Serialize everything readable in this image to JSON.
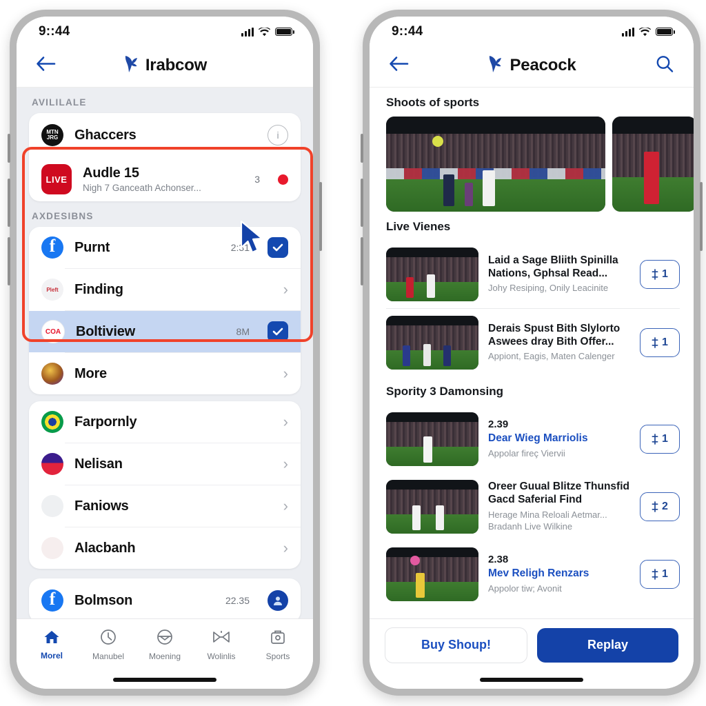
{
  "left_phone": {
    "status": {
      "time": "9::44"
    },
    "nav": {
      "brand": "Irabcow",
      "back_icon": "arrow-left-icon",
      "logo_icon": "peacock-logo-icon"
    },
    "sections": [
      {
        "label": "AVILILALE",
        "rows": [
          {
            "title": "Ghaccers",
            "sub": "",
            "avatar": "av-ghaccers",
            "avatar_text": "MTN JRG",
            "trailing": "info",
            "meta": ""
          },
          {
            "title": "Audle 15",
            "sub": "Nigh 7 Ganceath Achonser...",
            "avatar": "live",
            "avatar_text": "LIVE",
            "trailing": "reddot",
            "meta": "3"
          }
        ]
      },
      {
        "label": "AXDESIBNS",
        "highlighted": true,
        "rows": [
          {
            "title": "Purnt",
            "sub": "",
            "avatar": "av-fb",
            "avatar_text": "",
            "trailing": "check",
            "meta": "2:31"
          },
          {
            "title": "Finding",
            "sub": "",
            "avatar": "av-finding",
            "avatar_text": "Pleft",
            "trailing": "chevron",
            "meta": ""
          },
          {
            "title": "Boltiview",
            "sub": "",
            "avatar": "av-bolt",
            "avatar_text": "COA",
            "trailing": "check",
            "meta": "8M",
            "selected": true
          },
          {
            "title": "More",
            "sub": "",
            "avatar": "av-more",
            "avatar_text": "",
            "trailing": "chevron",
            "meta": ""
          }
        ]
      },
      {
        "label": "",
        "rows": [
          {
            "title": "Farpornly",
            "sub": "",
            "avatar": "av-brazil",
            "avatar_text": "",
            "trailing": "chevron",
            "meta": ""
          },
          {
            "title": "Nelisan",
            "sub": "",
            "avatar": "av-nelisan",
            "avatar_text": "",
            "trailing": "chevron",
            "meta": ""
          },
          {
            "title": "Faniows",
            "sub": "",
            "avatar": "av-faniows",
            "avatar_text": "",
            "trailing": "chevron",
            "meta": ""
          },
          {
            "title": "Alacbanh",
            "sub": "",
            "avatar": "av-alac",
            "avatar_text": "",
            "trailing": "chevron",
            "meta": ""
          }
        ]
      },
      {
        "label": "",
        "rows": [
          {
            "title": "Bolmson",
            "sub": "",
            "avatar": "av-fb",
            "avatar_text": "",
            "trailing": "person",
            "meta": "22.35"
          }
        ]
      }
    ],
    "tabs": [
      {
        "label": "Morel",
        "icon": "home-icon",
        "active": true
      },
      {
        "label": "Manubel",
        "icon": "clock-icon",
        "active": false
      },
      {
        "label": "Moening",
        "icon": "envelope-icon",
        "active": false
      },
      {
        "label": "Wolinlis",
        "icon": "bowtie-icon",
        "active": false
      },
      {
        "label": "Sports",
        "icon": "briefcase-icon",
        "active": false
      }
    ]
  },
  "right_phone": {
    "status": {
      "time": "9::44"
    },
    "nav": {
      "brand": "Peacock",
      "back_icon": "arrow-left-icon",
      "search_icon": "search-icon",
      "logo_icon": "peacock-logo-icon"
    },
    "hero_section": {
      "title": "Shoots of sports"
    },
    "sections": [
      {
        "title": "Live Vienes",
        "items": [
          {
            "time": "",
            "headline": "Laid a Sage Bliith Spinilla Nations, Gphsal Read...",
            "desc": "Johy Resiping, Onily Leacinite",
            "pill": "1",
            "link": false
          },
          {
            "time": "",
            "headline": "Derais Spust Bith Slylorto Aswees dray Bith Offer...",
            "desc": "Appiont, Eagis, Maten Calenger",
            "pill": "1",
            "link": false
          }
        ]
      },
      {
        "title": "Spority 3 Damonsing",
        "items": [
          {
            "time": "2.39",
            "headline": "Dear Wieg Marriolis",
            "desc": "Appolar fireç Viervii",
            "pill": "1",
            "link": true
          },
          {
            "time": "",
            "headline": "Oreer Guual Blitze Thunsfid Gacd Saferial Find",
            "desc": "Herage Mina Reloali Aetmar... Bradanh Live Wilkine",
            "pill": "2",
            "link": false
          },
          {
            "time": "2.38",
            "headline": "Mev Religh Renzars",
            "desc": "Appolor tiw; Avonit",
            "pill": "1",
            "link": true
          }
        ]
      }
    ],
    "actions": {
      "secondary": "Buy Shoup!",
      "primary": "Replay"
    }
  },
  "colors": {
    "accent_blue": "#1442a8",
    "link_blue": "#1b4fc0",
    "highlight_red": "#f0422a",
    "live_red": "#cf0a20",
    "selected_row": "#c5d6f2",
    "page_bg": "#eceef2"
  }
}
